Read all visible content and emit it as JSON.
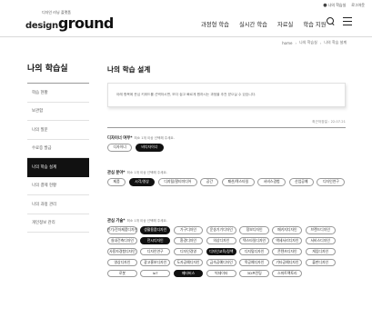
{
  "header": {
    "top_links": {
      "user": "나의 학습실",
      "logout": "로그아웃"
    },
    "logo": {
      "sub": "디자인 러닝 플랫폼",
      "main_a": "design",
      "main_b": "ground"
    },
    "gnb": [
      "과정형 학습",
      "실시간 학습",
      "자료실",
      "학습 지원"
    ]
  },
  "breadcrumb": [
    "home",
    "나의 학습실",
    "나의 학습 설계"
  ],
  "sidebar": {
    "title": "나의 학습실",
    "items": [
      {
        "label": "학습 현황",
        "active": false
      },
      {
        "label": "보관함",
        "active": false
      },
      {
        "label": "나의 질문",
        "active": false
      },
      {
        "label": "수료증 발급",
        "active": false
      },
      {
        "label": "나의 학습 설계",
        "active": true
      },
      {
        "label": "나의 결제 현황",
        "active": false
      },
      {
        "label": "나의 과정 관리",
        "active": false
      },
      {
        "label": "개인정보 관리",
        "active": false
      }
    ]
  },
  "main": {
    "title": "나의 학습 설계",
    "notice": "아래 항목에 관심 키워드를 선택하시면, 보다 쉽고 빠르게 원하시는 과정을 추천 받으실 수 있습니다.",
    "updated": "최근저장일 : 22.07.21",
    "sections": [
      {
        "label": "디자이너 여부*",
        "hint": "최소 1개 이상 선택해 주세요.",
        "grid": false,
        "chips": [
          {
            "label": "디자이너",
            "on": false
          },
          {
            "label": "비디자이너",
            "on": true
          }
        ]
      },
      {
        "label": "관심 분야*",
        "hint": "최소 1개 이상 선택해 주세요.",
        "grid": false,
        "chips": [
          {
            "label": "제품",
            "on": false
          },
          {
            "label": "시각/영상",
            "on": true
          },
          {
            "label": "디지털/멀티미디어",
            "on": false
          },
          {
            "label": "공간",
            "on": false
          },
          {
            "label": "패션/텍스타일",
            "on": false
          },
          {
            "label": "서비스경험",
            "on": false
          },
          {
            "label": "산업공예",
            "on": false
          },
          {
            "label": "디자인연구",
            "on": false
          }
        ]
      },
      {
        "label": "관심 기술*",
        "hint": "최소 1개 이상 선택해 주세요.",
        "grid": true,
        "chips": [
          {
            "label": "인기/전자제품디자인",
            "on": false
          },
          {
            "label": "생활용품디자인",
            "on": true
          },
          {
            "label": "가구디자인",
            "on": false
          },
          {
            "label": "운송기기디자인",
            "on": false
          },
          {
            "label": "정보디자인",
            "on": false
          },
          {
            "label": "패키지디자인",
            "on": false
          },
          {
            "label": "브랜드디자인",
            "on": false
          },
          {
            "label": "실내건축디자인",
            "on": false
          },
          {
            "label": "전시디자인",
            "on": true
          },
          {
            "label": "환경디자인",
            "on": false
          },
          {
            "label": "의상디자인",
            "on": false
          },
          {
            "label": "텍스타일디자인",
            "on": false
          },
          {
            "label": "액세서리디자인",
            "on": false
          },
          {
            "label": "서비스디자인",
            "on": false
          },
          {
            "label": "사용자경험디자인",
            "on": false
          },
          {
            "label": "디자인연구",
            "on": false
          },
          {
            "label": "디자인경영",
            "on": false
          },
          {
            "label": "디자인교육/정책",
            "on": true
          },
          {
            "label": "디지털디자인",
            "on": false
          },
          {
            "label": "콘텐츠디자인",
            "on": false
          },
          {
            "label": "게임디자인",
            "on": false
          },
          {
            "label": "영상디자인",
            "on": false
          },
          {
            "label": "광고홍보디자인",
            "on": false
          },
          {
            "label": "도자공예디자인",
            "on": false
          },
          {
            "label": "금속공예디자인",
            "on": false
          },
          {
            "label": "목공예디자인",
            "on": false
          },
          {
            "label": "기타공예디자인",
            "on": false
          },
          {
            "label": "출판디자인",
            "on": false
          },
          {
            "label": "로봇",
            "on": false
          },
          {
            "label": "IoT",
            "on": false
          },
          {
            "label": "메타버스",
            "on": true
          },
          {
            "label": "빅데이터",
            "on": false
          },
          {
            "label": "3D프린팅",
            "on": false
          },
          {
            "label": "스마트팩토리",
            "on": false
          }
        ]
      }
    ]
  }
}
